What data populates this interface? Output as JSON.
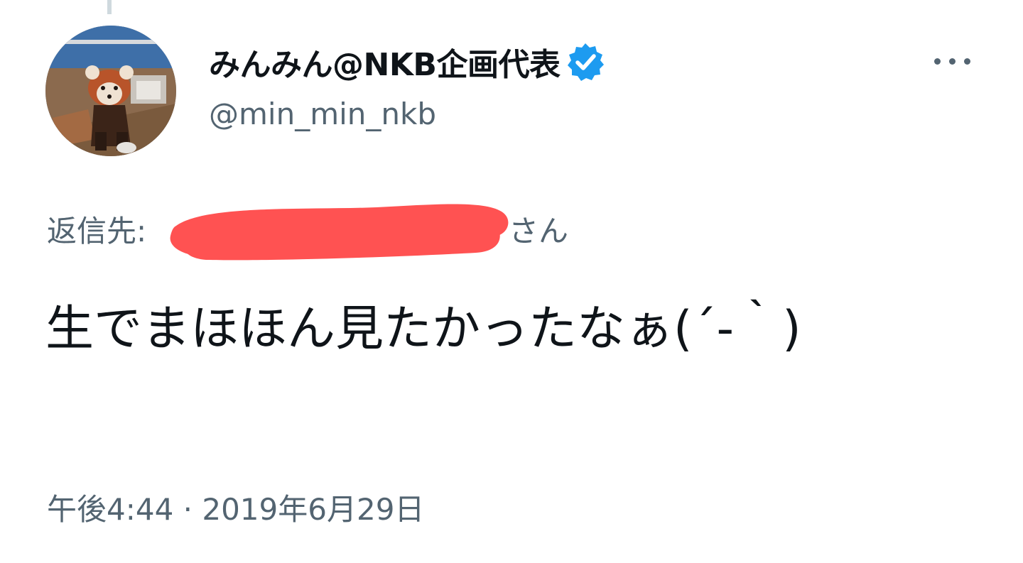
{
  "user": {
    "display_name": "みんみん@NKB企画代表",
    "handle": "@min_min_nkb",
    "verified": true,
    "verified_icon": "verified-badge-icon",
    "avatar_icon": "red-panda-photo"
  },
  "reply": {
    "prefix": "返信先:",
    "target": "",
    "suffix": "さん",
    "redaction_color": "#ff5252"
  },
  "tweet": {
    "text": "生でまほほん見たかったなぁ(´-｀)"
  },
  "meta": {
    "timestamp": "午後4:44 · 2019年6月29日"
  },
  "colors": {
    "primary_text": "#0f1419",
    "secondary_text": "#536471",
    "verified_blue": "#1d9bf0",
    "thread_line": "#cfd9de"
  },
  "menu": {
    "more_icon": "more-options-icon"
  }
}
